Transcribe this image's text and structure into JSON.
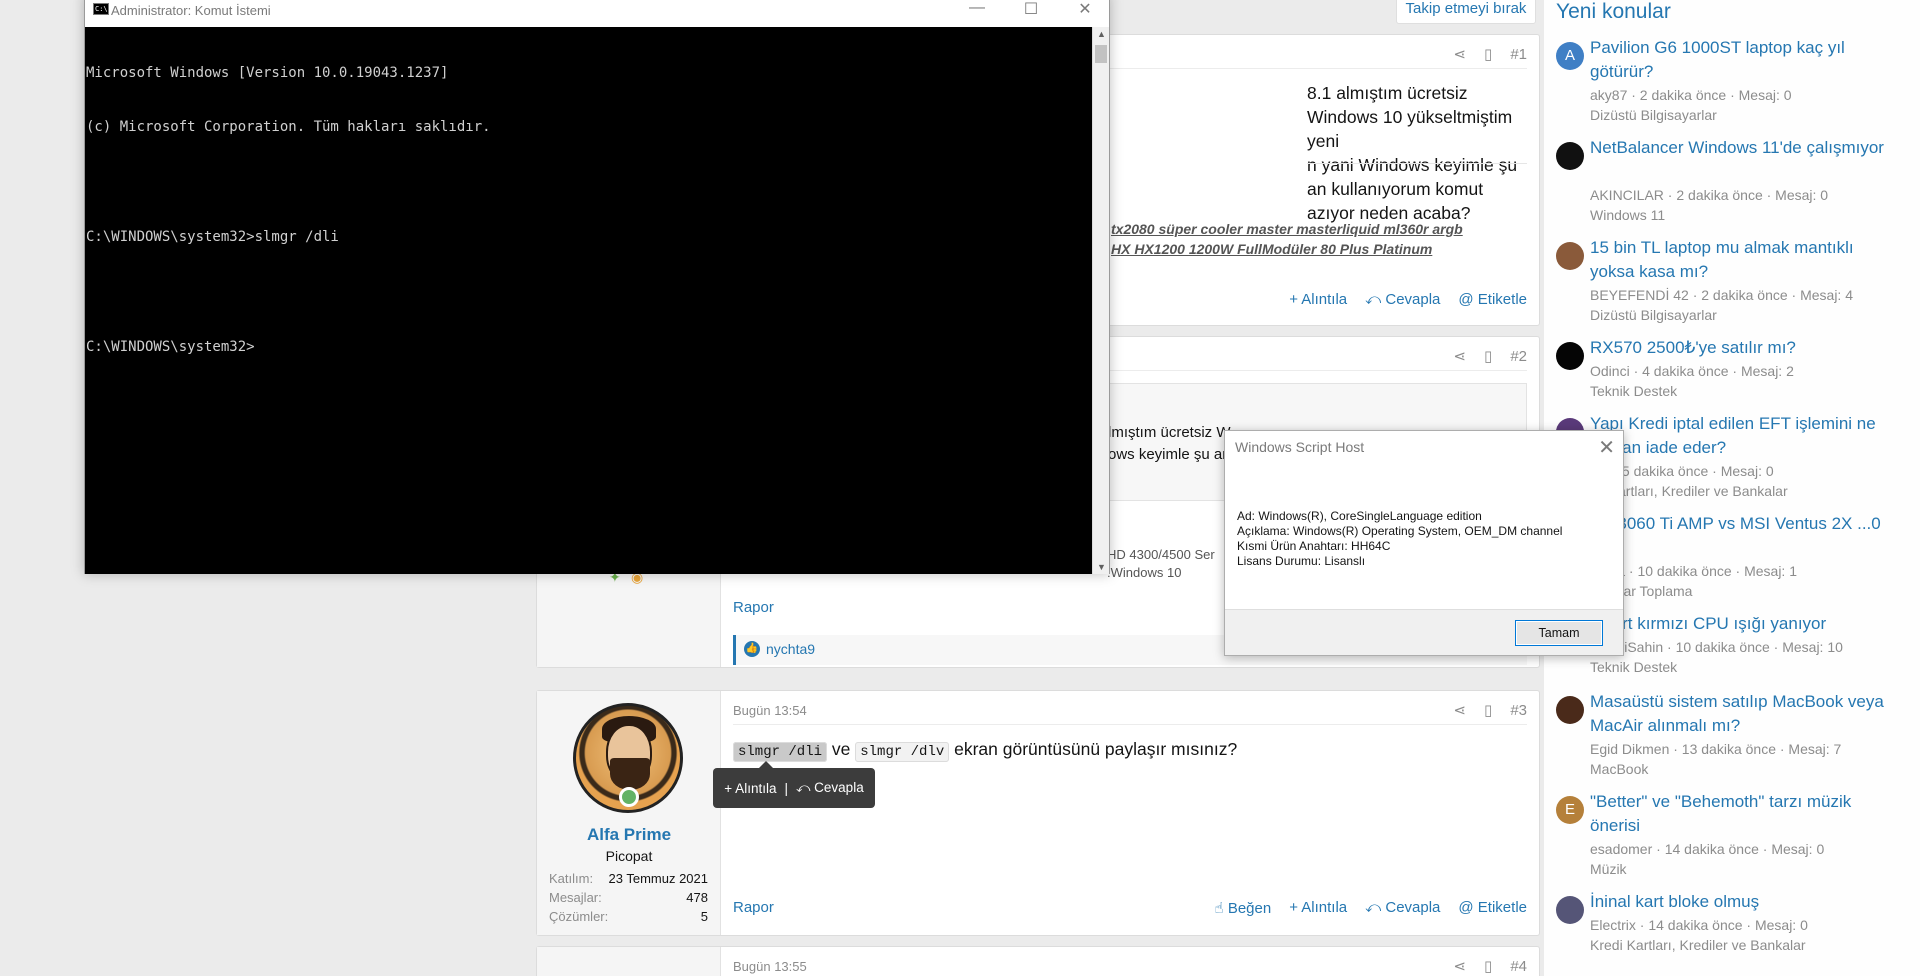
{
  "forum": {
    "unwatch_label": "Takip etmeyi bırak",
    "post1": {
      "number": "#1",
      "text_lines": [
        "8.1 almıştım ücretsiz Windows 10 yükseltmiştim yeni",
        "n yani Windows keyimle şu an kullanıyorum komut",
        "azıyor neden acaba?"
      ],
      "sig_lines": [
        "tx2080 süper cooler master masterliquid ml360r argb",
        "HX HX1200 1200W FullModüler 80 Plus Platinum"
      ]
    },
    "post2": {
      "number": "#2",
      "quote_lines": [
        "lmıştım ücretsiz W",
        "ows keyimle şu an"
      ],
      "sig_line": "HD 4300/4500 Ser",
      "sig_line2": ":Windows 10",
      "reaction_user": "nychta9"
    },
    "post3": {
      "date": "Bugün 13:54",
      "number": "#3",
      "code1": "slmgr /dli",
      "mid": " ve ",
      "code2": "slmgr /dlv",
      "tail": " ekran görüntüsünü paylaşır mısınız?",
      "username": "Alfa Prime",
      "usertitle": "Picopat",
      "stats": [
        {
          "k": "Katılım:",
          "v": "23 Temmuz 2021"
        },
        {
          "k": "Mesajlar:",
          "v": "478"
        },
        {
          "k": "Çözümler:",
          "v": "5"
        }
      ]
    },
    "post4": {
      "date": "Bugün 13:55",
      "number": "#4"
    },
    "actions": {
      "like": "Beğen",
      "quote": "+ Alıntıla",
      "reply": "Cevapla",
      "tag": "@ Etiketle"
    },
    "report": "Rapor",
    "tooltip": {
      "quote": "+ Alıntıla",
      "sep": "|",
      "reply": "Cevapla"
    }
  },
  "sidebar": {
    "title": "Yeni konular",
    "threads": [
      {
        "avatar": "A",
        "color": "#3f7fc5",
        "title": "Pavilion G6 1000ST laptop kaç yıl götürür?",
        "meta": "aky87 · 2 dakika önce · Mesaj: 0",
        "forum": "Dizüstü Bilgisayarlar"
      },
      {
        "avatar": "",
        "color": "#111111",
        "title": "NetBalancer Windows 11'de çalışmıyor",
        "meta": "AKINCILAR · 2 dakika önce · Mesaj: 0",
        "forum": "Windows 11"
      },
      {
        "avatar": "",
        "color": "#8a5a3a",
        "title": "15 bin TL laptop mu almak mantıklı yoksa kasa mı?",
        "meta": "BEYEFENDİ 42 · 2 dakika önce · Mesaj: 4",
        "forum": "Dizüstü Bilgisayarlar"
      },
      {
        "avatar": "",
        "color": "#050505",
        "title": "RX570 2500₺'ye satılır mı?",
        "meta": "Odinci · 4 dakika önce · Mesaj: 2",
        "forum": "Teknik Destek"
      },
      {
        "avatar": "",
        "color": "#5a3a7a",
        "title": "Yapı Kredi iptal edilen EFT işlemini ne zaman iade eder?",
        "meta": "...n · 5 dakika önce · Mesaj: 0",
        "forum": "...i Kartları, Krediler ve Bankalar"
      },
      {
        "avatar": "",
        "color": "#6a6a6a",
        "title": "...c 3060 Ti AMP vs MSI Ventus 2X ...0 Ti",
        "meta": "...ona · 10 dakika önce · Mesaj: 1",
        "forum": "...sayar Toplama"
      },
      {
        "avatar": "",
        "color": "#7a7a7a",
        "title": "...kart kırmızı CPU ışığı yanıyor",
        "meta": "...NuriSahin · 10 dakika önce · Mesaj: 10",
        "forum": "Teknik Destek"
      },
      {
        "avatar": "",
        "color": "#4a2a1a",
        "title": "Masaüstü sistem satılıp MacBook veya MacAir alınmalı mı?",
        "meta": "Egid Dikmen · 13 dakika önce · Mesaj: 7",
        "forum": "MacBook"
      },
      {
        "avatar": "E",
        "color": "#b5803a",
        "title": "\"Better\" ve \"Behemoth\" tarzı müzik önerisi",
        "meta": "esadomer · 14 dakika önce · Mesaj: 0",
        "forum": "Müzik"
      },
      {
        "avatar": "",
        "color": "#555577",
        "title": "İninal kart bloke olmuş",
        "meta": "Electrix · 14 dakika önce · Mesaj: 0",
        "forum": "Kredi Kartları, Krediler ve Bankalar"
      }
    ]
  },
  "cmd": {
    "title": "Administrator: Komut İstemi",
    "icon_text": "C:\\",
    "lines": [
      "Microsoft Windows [Version 10.0.19043.1237]",
      "(c) Microsoft Corporation. Tüm hakları saklıdır.",
      "",
      "C:\\WINDOWS\\system32>slmgr /dli",
      "",
      "C:\\WINDOWS\\system32>"
    ]
  },
  "wsh": {
    "title": "Windows Script Host",
    "lines": [
      "Ad: Windows(R), CoreSingleLanguage edition",
      "Açıklama: Windows(R) Operating System, OEM_DM channel",
      "Kısmi Ürün Anahtarı: HH64C",
      "Lisans Durumu: Lisanslı"
    ],
    "ok_label": "Tamam"
  }
}
